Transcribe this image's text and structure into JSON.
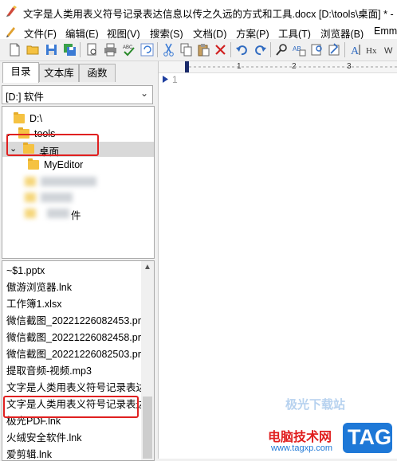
{
  "window": {
    "title": "文字是人类用表义符号记录表达信息以传之久远的方式和工具.docx [D:\\tools\\桌面] * - E"
  },
  "menu": {
    "items": [
      "文件(F)",
      "编辑(E)",
      "视图(V)",
      "搜索(S)",
      "文档(D)",
      "方案(P)",
      "工具(T)",
      "浏览器(B)",
      "Emm"
    ]
  },
  "toolbar": {
    "icons": [
      "new-file-icon",
      "open-folder-icon",
      "save-icon",
      "save-all-icon",
      "print-preview-icon",
      "print-icon",
      "spell-check-icon",
      "refresh-icon",
      "cut-icon",
      "copy-icon",
      "paste-icon",
      "delete-icon",
      "undo-icon",
      "redo-icon",
      "find-icon",
      "replace-icon",
      "find-in-files-icon",
      "goto-icon",
      "font-size-icon",
      "hex-icon",
      "web-icon",
      "wrap-icon"
    ],
    "labels": {
      "replace": "AB",
      "font": "A",
      "hex": "Hx",
      "wrap": "W"
    }
  },
  "left_panel": {
    "tabs": [
      "目录",
      "文本库",
      "函数"
    ],
    "active_tab": "目录",
    "drive": "[D:] 软件",
    "tree": [
      {
        "label": "D:\\"
      },
      {
        "label": "tools"
      },
      {
        "label": "桌面",
        "selected": true
      },
      {
        "label": "MyEditor"
      },
      {
        "label": "件"
      }
    ],
    "files": [
      "~$1.pptx",
      "傲游浏览器.lnk",
      "工作簿1.xlsx",
      "微信截图_20221226082453.pn",
      "微信截图_20221226082458.pn",
      "微信截图_20221226082503.pn",
      "提取音频-视频.mp3",
      "文字是人类用表义符号记录表达",
      "文字是人类用表义符号记录表达",
      "极光PDF.lnk",
      "火绒安全软件.lnk",
      "爱剪辑.lnk"
    ]
  },
  "editor": {
    "ruler_numbers": [
      "1",
      "2",
      "3"
    ],
    "line_number": "1"
  },
  "watermark": {
    "site_name": "电脑技术网",
    "url": "www.tagxp.com",
    "badge": "TAG",
    "faded_text": "极光下载站"
  },
  "colors": {
    "annotation_red": "#e02020",
    "selection": "#d9d9d9",
    "watermark_blue": "#1e78d7",
    "watermark_red": "#e01e1e"
  }
}
